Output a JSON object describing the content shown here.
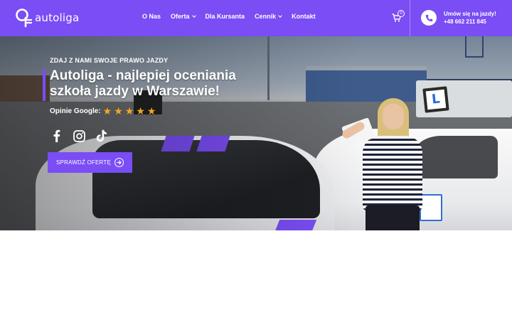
{
  "header": {
    "logo_text": "autoliga",
    "nav": [
      {
        "label": "O Nas",
        "has_dropdown": false
      },
      {
        "label": "Oferta",
        "has_dropdown": true
      },
      {
        "label": "Dla Kursanta",
        "has_dropdown": false
      },
      {
        "label": "Cennik",
        "has_dropdown": true
      },
      {
        "label": "Kontakt",
        "has_dropdown": false
      }
    ],
    "cart_count": "0",
    "cta_title": "Umów się na jazdy!",
    "cta_phone": "+48 662 211 845"
  },
  "hero": {
    "eyebrow": "ZDAJ Z NAMI SWOJE PRAWO JAZDY",
    "title": "Autoliga - najlepiej oceniania szkoła jazdy w Warszawie!",
    "rating_label": "Opinie Google:",
    "rating_stars": 5,
    "socials": [
      "facebook-icon",
      "instagram-icon",
      "tiktok-icon"
    ],
    "button_label": "SPRAWDŹ OFERTĘ",
    "sign_letter": "L"
  },
  "colors": {
    "brand": "#7a4df5",
    "star": "#f5a623",
    "white": "#ffffff"
  }
}
